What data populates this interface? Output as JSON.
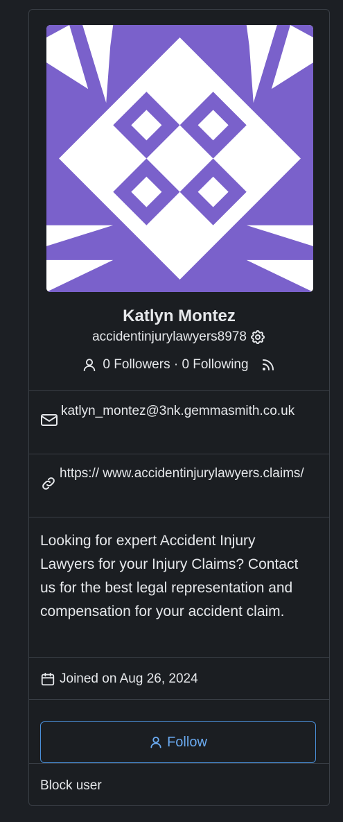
{
  "profile": {
    "avatar_icon": "identicon-avatar",
    "avatar_colors": {
      "primary": "#7a61cb",
      "background": "#ffffff"
    },
    "display_name": "Katlyn Montez",
    "username": "accidentinjurylawyers8978",
    "settings_icon": "gear-icon",
    "follow_stats": "0 Followers · 0 Following",
    "followers_icon": "person-icon",
    "rss_icon": "rss-icon",
    "email_icon": "mail-icon",
    "email": "katlyn_montez@3nk.gemmasmith.co.uk",
    "website_icon": "link-icon",
    "website": "https:// www.accidentinjurylawyers.claims/",
    "bio": "Looking for expert Accident Injury Lawyers for your Injury Claims? Contact us for the best legal representation and compensation for your accident claim.",
    "joined_icon": "calendar-icon",
    "joined": "Joined on Aug 26, 2024",
    "follow_label": "Follow",
    "block_label": "Block user"
  },
  "colors": {
    "background": "#1c1f24",
    "card_border": "#3a3f46",
    "accent": "#6aaaf0",
    "text": "#e6e8eb"
  }
}
